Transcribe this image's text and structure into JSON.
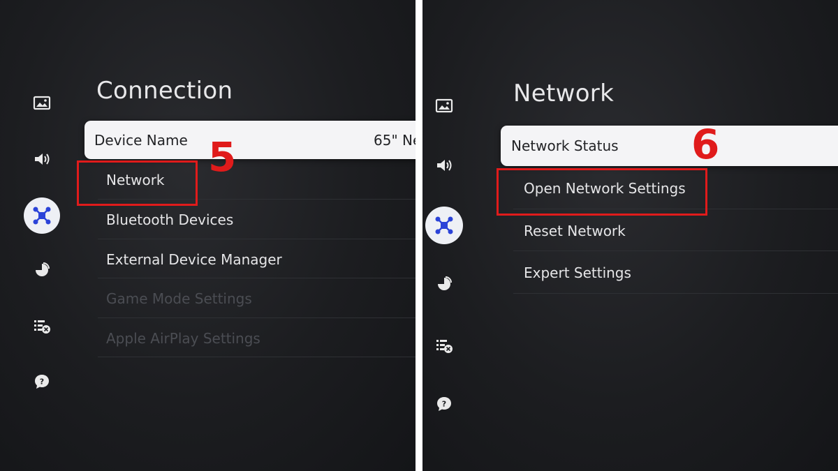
{
  "colors": {
    "highlight": "#e01b1b",
    "active_icon_bg": "#eef0f5",
    "active_icon": "#2b43d8",
    "focused_row_bg": "#f4f4f6",
    "disabled_text": "#4b4d53"
  },
  "sidebar_icons": [
    "picture-icon",
    "sound-icon",
    "connection-icon",
    "broadcast-icon",
    "accessibility-icon",
    "support-icon"
  ],
  "left": {
    "title": "Connection",
    "items": [
      {
        "label": "Device Name",
        "value": "65\" Ne",
        "state": "focused"
      },
      {
        "label": "Network",
        "state": "normal"
      },
      {
        "label": "Bluetooth Devices",
        "state": "normal"
      },
      {
        "label": "External Device Manager",
        "state": "normal"
      },
      {
        "label": "Game Mode Settings",
        "state": "disabled"
      },
      {
        "label": "Apple AirPlay Settings",
        "state": "disabled"
      }
    ],
    "step": "5"
  },
  "right": {
    "title": "Network",
    "items": [
      {
        "label": "Network Status",
        "state": "focused"
      },
      {
        "label": "Open Network Settings",
        "state": "normal"
      },
      {
        "label": "Reset Network",
        "state": "normal"
      },
      {
        "label": "Expert Settings",
        "state": "normal"
      }
    ],
    "step": "6"
  }
}
